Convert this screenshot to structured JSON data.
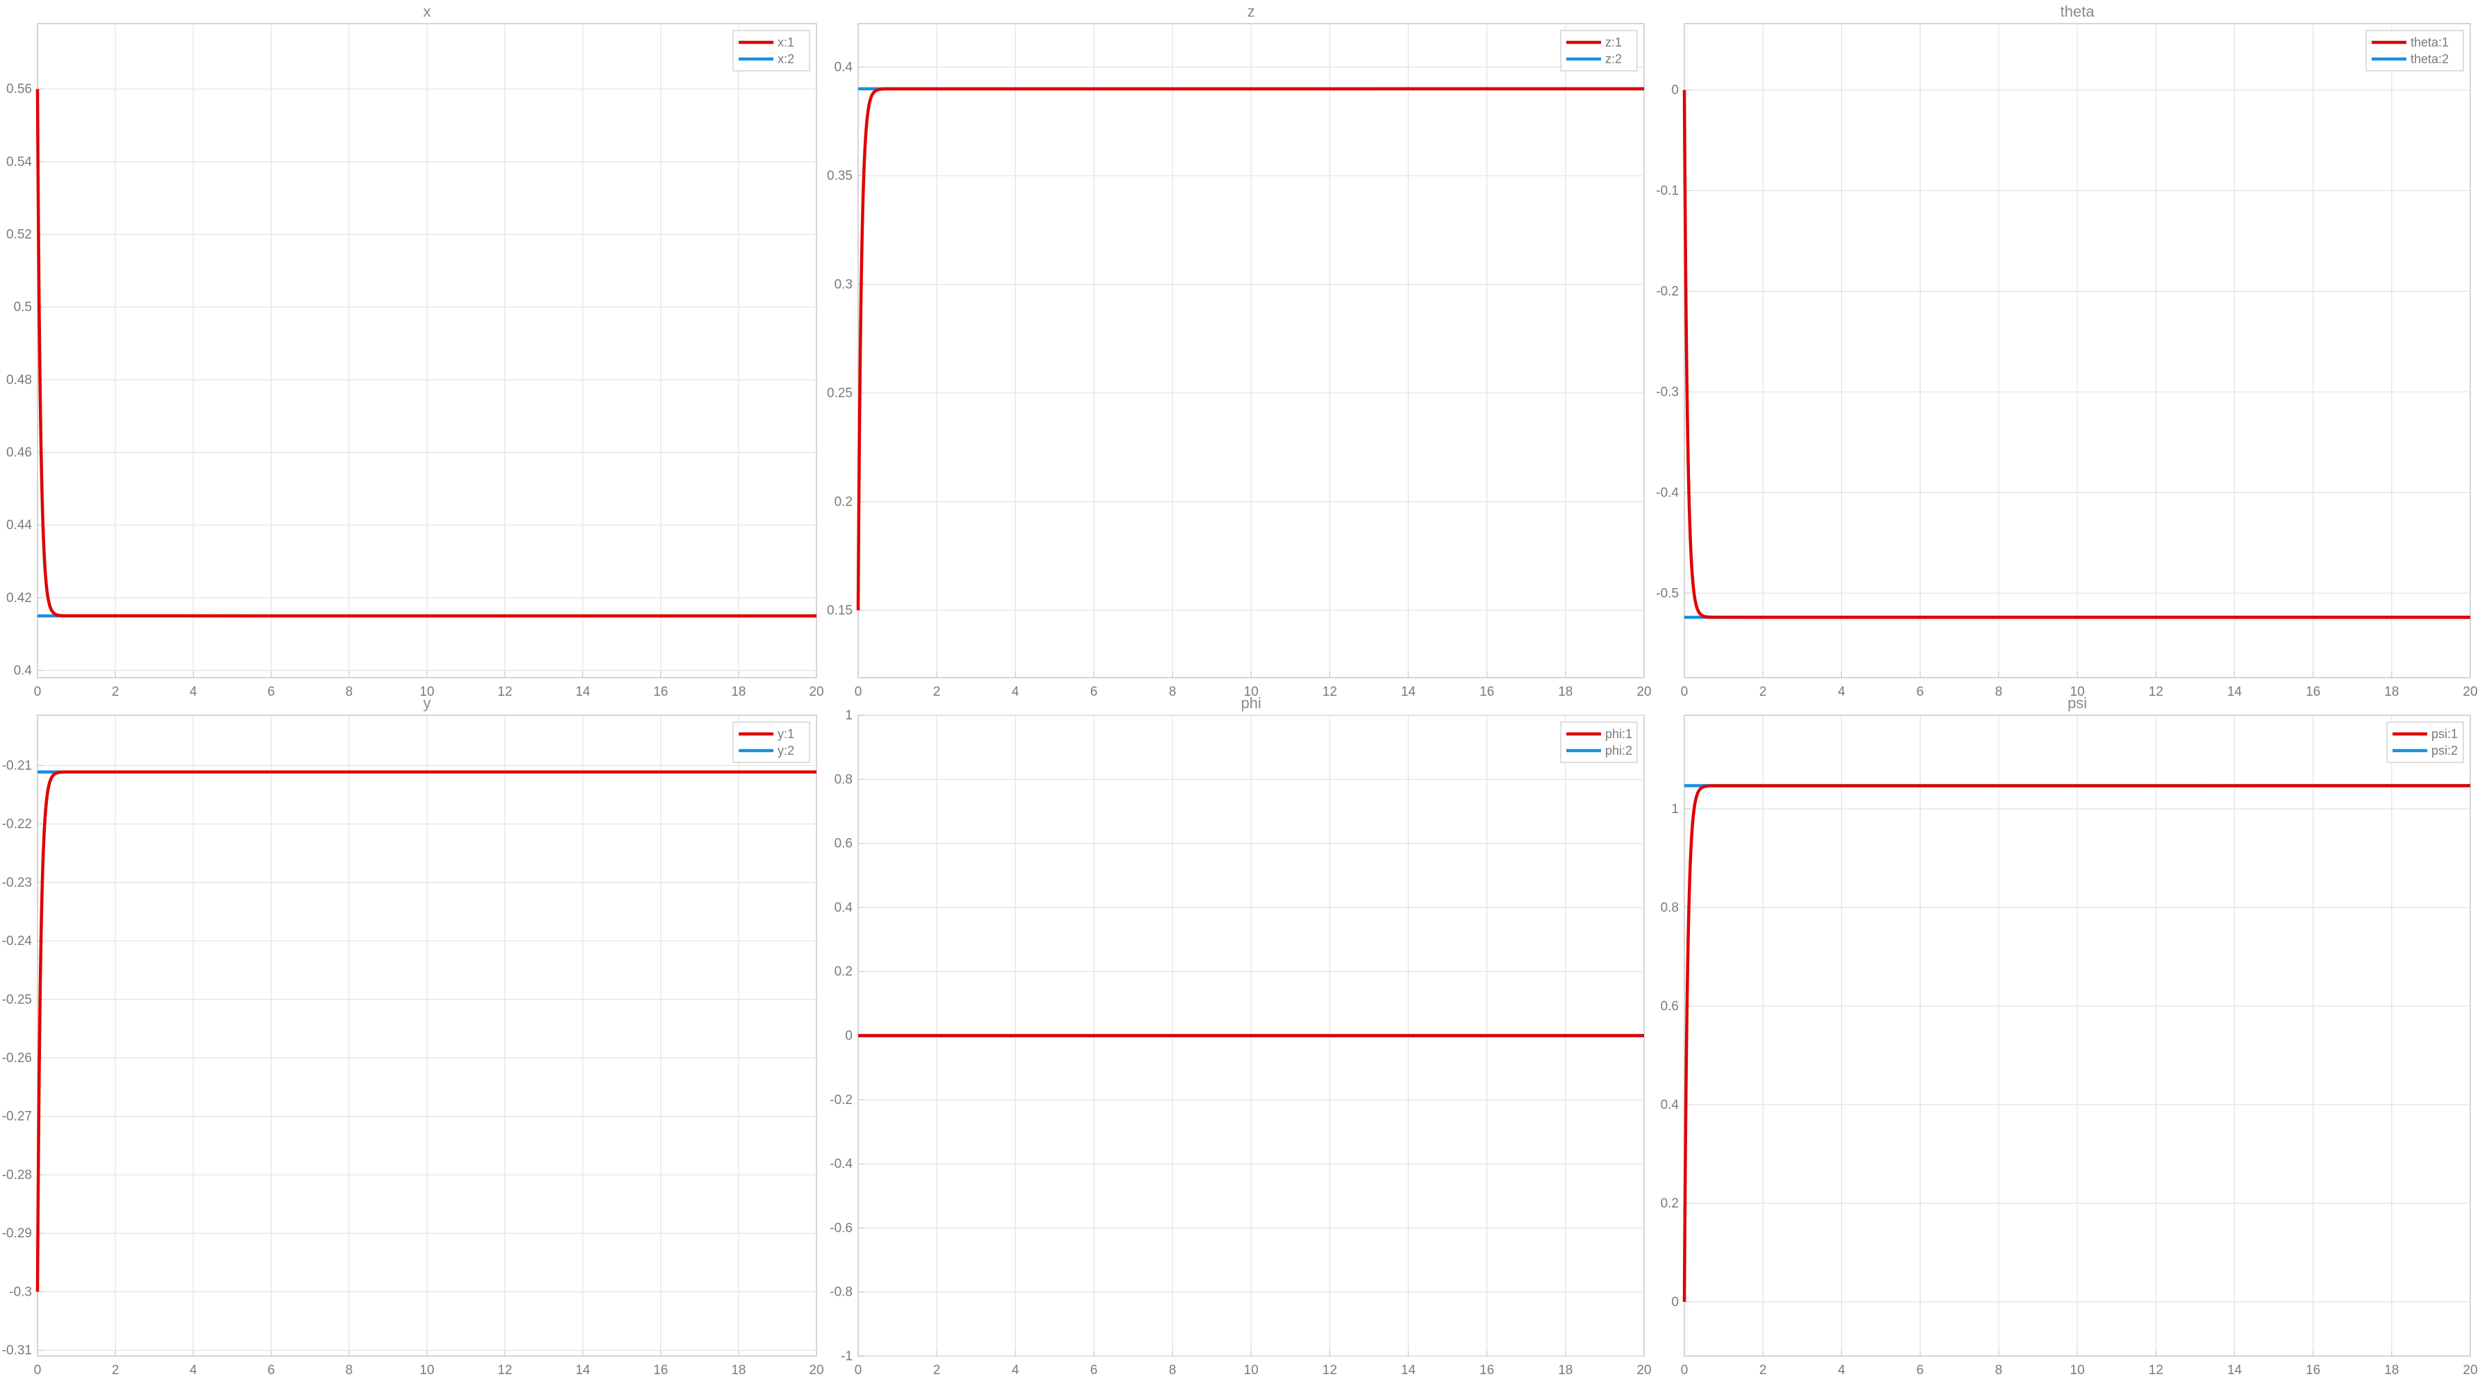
{
  "figure": {
    "colors": {
      "series1": "#e00000",
      "series2": "#1a8fdc",
      "grid": "#e2e2e2",
      "axis": "#c9c9c9",
      "text": "#7a7a7a"
    }
  },
  "chart_data": [
    {
      "type": "line",
      "title": "x",
      "xlim": [
        0,
        20
      ],
      "ylim": [
        0.398,
        0.578
      ],
      "xticks": [
        0,
        2,
        4,
        6,
        8,
        10,
        12,
        14,
        16,
        18,
        20
      ],
      "yticks": [
        0.4,
        0.42,
        0.44,
        0.46,
        0.48,
        0.5,
        0.52,
        0.54,
        0.56
      ],
      "ytick_labels": [
        "0.4",
        "0.42",
        "0.44",
        "0.46",
        "0.48",
        "0.5",
        "0.52",
        "0.54",
        "0.56"
      ],
      "grid": true,
      "legend": "top-right",
      "series": [
        {
          "name": "x:1",
          "color": "#e00000",
          "start": 0.56,
          "final": 0.415,
          "tau": 0.08,
          "x_end": 0.7
        },
        {
          "name": "x:2",
          "color": "#1a8fdc",
          "constant": 0.415
        }
      ]
    },
    {
      "type": "line",
      "title": "z",
      "xlim": [
        0,
        20
      ],
      "ylim": [
        0.119,
        0.42
      ],
      "xticks": [
        0,
        2,
        4,
        6,
        8,
        10,
        12,
        14,
        16,
        18,
        20
      ],
      "yticks": [
        0.15,
        0.2,
        0.25,
        0.3,
        0.35,
        0.4
      ],
      "ytick_labels": [
        "0.15",
        "0.2",
        "0.25",
        "0.3",
        "0.35",
        "0.4"
      ],
      "grid": true,
      "legend": "top-right",
      "series": [
        {
          "name": "z:1",
          "color": "#e00000",
          "start": 0.15,
          "final": 0.39,
          "tau": 0.08,
          "x_end": 0.7
        },
        {
          "name": "z:2",
          "color": "#1a8fdc",
          "constant": 0.39
        }
      ]
    },
    {
      "type": "line",
      "title": "theta",
      "xlim": [
        0,
        20
      ],
      "ylim": [
        -0.584,
        0.066
      ],
      "xticks": [
        0,
        2,
        4,
        6,
        8,
        10,
        12,
        14,
        16,
        18,
        20
      ],
      "yticks": [
        -0.5,
        -0.4,
        -0.3,
        -0.2,
        -0.1,
        0
      ],
      "ytick_labels": [
        "-0.5",
        "-0.4",
        "-0.3",
        "-0.2",
        "-0.1",
        "0"
      ],
      "grid": true,
      "legend": "top-right",
      "series": [
        {
          "name": "theta:1",
          "color": "#e00000",
          "start": 0.0,
          "final": -0.524,
          "tau": 0.08,
          "x_end": 0.7
        },
        {
          "name": "theta:2",
          "color": "#1a8fdc",
          "constant": -0.524
        }
      ]
    },
    {
      "type": "line",
      "title": "y",
      "xlim": [
        0,
        20
      ],
      "ylim": [
        -0.311,
        -0.2014
      ],
      "xticks": [
        0,
        2,
        4,
        6,
        8,
        10,
        12,
        14,
        16,
        18,
        20
      ],
      "yticks": [
        -0.31,
        -0.3,
        -0.29,
        -0.28,
        -0.27,
        -0.26,
        -0.25,
        -0.24,
        -0.23,
        -0.22,
        -0.21
      ],
      "ytick_labels": [
        "-0.31",
        "-0.3",
        "-0.29",
        "-0.28",
        "-0.27",
        "-0.26",
        "-0.25",
        "-0.24",
        "-0.23",
        "-0.22",
        "-0.21"
      ],
      "grid": true,
      "legend": "top-right",
      "series": [
        {
          "name": "y:1",
          "color": "#e00000",
          "start": -0.3,
          "final": -0.2111,
          "tau": 0.08,
          "x_end": 0.7
        },
        {
          "name": "y:2",
          "color": "#1a8fdc",
          "constant": -0.2111
        }
      ]
    },
    {
      "type": "line",
      "title": "phi",
      "xlim": [
        0,
        20
      ],
      "ylim": [
        -1,
        1
      ],
      "xticks": [
        0,
        2,
        4,
        6,
        8,
        10,
        12,
        14,
        16,
        18,
        20
      ],
      "yticks": [
        -1,
        -0.8,
        -0.6,
        -0.4,
        -0.2,
        0,
        0.2,
        0.4,
        0.6,
        0.8,
        1
      ],
      "ytick_labels": [
        "-1",
        "-0.8",
        "-0.6",
        "-0.4",
        "-0.2",
        "0",
        "0.2",
        "0.4",
        "0.6",
        "0.8",
        "1"
      ],
      "grid": true,
      "legend": "top-right",
      "series": [
        {
          "name": "phi:1",
          "color": "#e00000",
          "constant": 0
        },
        {
          "name": "phi:2",
          "color": "#1a8fdc",
          "constant": 0
        }
      ]
    },
    {
      "type": "line",
      "title": "psi",
      "xlim": [
        0,
        20
      ],
      "ylim": [
        -0.11,
        1.19
      ],
      "xticks": [
        0,
        2,
        4,
        6,
        8,
        10,
        12,
        14,
        16,
        18,
        20
      ],
      "yticks": [
        0,
        0.2,
        0.4,
        0.6,
        0.8,
        1
      ],
      "ytick_labels": [
        "0",
        "0.2",
        "0.4",
        "0.6",
        "0.8",
        "1"
      ],
      "grid": true,
      "legend": "top-right",
      "series": [
        {
          "name": "psi:1",
          "color": "#e00000",
          "start": 0.0,
          "final": 1.047,
          "tau": 0.08,
          "x_end": 0.7
        },
        {
          "name": "psi:2",
          "color": "#1a8fdc",
          "constant": 1.047
        }
      ]
    }
  ]
}
